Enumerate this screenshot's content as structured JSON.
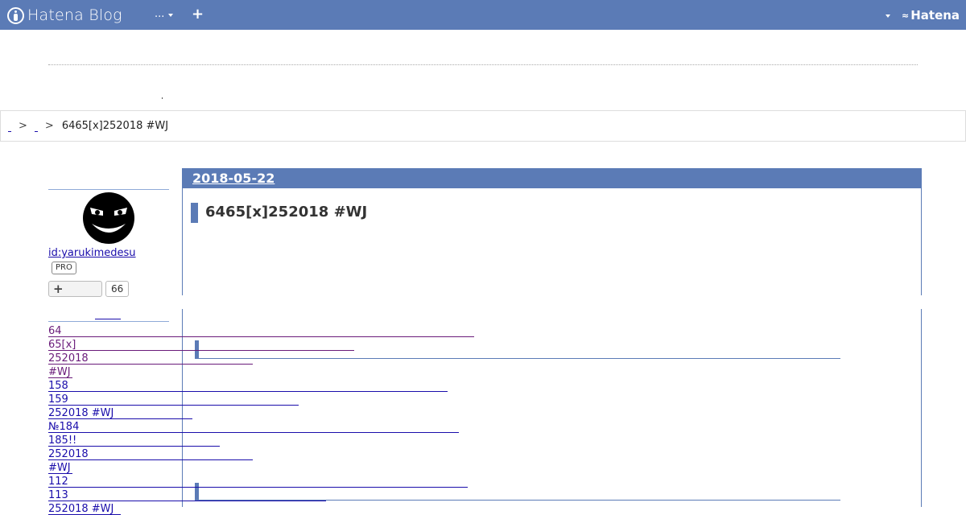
{
  "navbar": {
    "brand": "Hatena Blog",
    "menu_label": "...",
    "plus_label": "+",
    "hatena_label": "Hatena"
  },
  "breadcrumb": {
    "separator": ">",
    "current": "6465[x]252018 #WJ"
  },
  "profile": {
    "id": "id:yarukimedesu",
    "badge": "PRO",
    "subscribe_label": "+",
    "subscriber_count": "66"
  },
  "entry": {
    "date": "2018-05-22",
    "title": "6465[x]252018 #WJ"
  },
  "sidebar_links": [
    {
      "text": "64",
      "style": "visited"
    },
    {
      "text": "65[x]",
      "style": "visited"
    },
    {
      "text": "252018",
      "style": "visited"
    },
    {
      "text": "#WJ",
      "style": "visited"
    },
    {
      "text": "158",
      "style": "unvisited"
    },
    {
      "text": "159",
      "style": "unvisited"
    },
    {
      "text": "252018 #WJ",
      "style": "unvisited"
    },
    {
      "text": "№184",
      "style": "unvisited"
    },
    {
      "text": "185!!",
      "style": "unvisited"
    },
    {
      "text": "252018",
      "style": "unvisited"
    },
    {
      "text": "#WJ",
      "style": "unvisited"
    },
    {
      "text": "112",
      "style": "unvisited"
    },
    {
      "text": "113",
      "style": "unvisited"
    },
    {
      "text": "252018 #WJ",
      "style": "unvisited"
    }
  ],
  "colors": {
    "accent": "#5b7bb6",
    "link": "#1a0dab",
    "visited": "#6a1b7a"
  }
}
